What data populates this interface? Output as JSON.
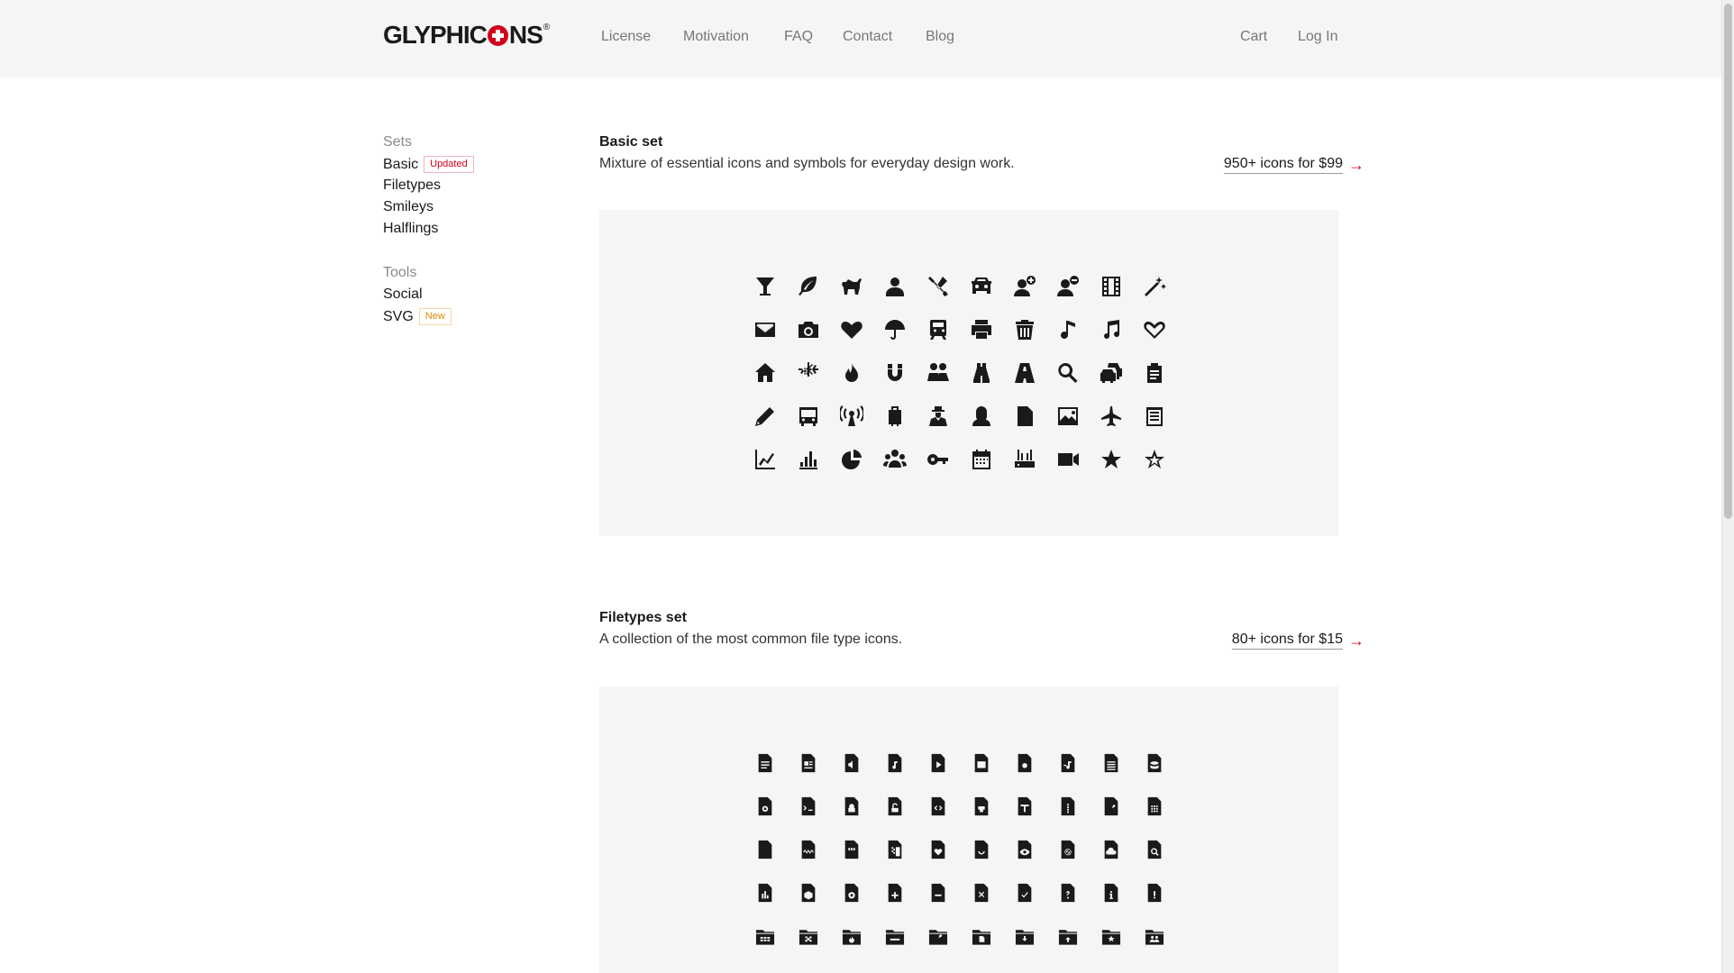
{
  "brand": {
    "logo_pre": "GLYPHIC",
    "logo_post": "NS",
    "registered": "®"
  },
  "nav": {
    "license": "License",
    "motivation": "Motivation",
    "faq": "FAQ",
    "contact": "Contact",
    "blog": "Blog",
    "cart": "Cart",
    "login": "Log In"
  },
  "sidebar": {
    "sets_heading": "Sets",
    "sets": [
      {
        "label": "Basic",
        "badge": "Updated"
      },
      {
        "label": "Filetypes"
      },
      {
        "label": "Smileys"
      },
      {
        "label": "Halflings"
      }
    ],
    "tools_heading": "Tools",
    "tools": [
      {
        "label": "Social"
      },
      {
        "label": "SVG",
        "badge": "New"
      }
    ]
  },
  "sections": {
    "basic": {
      "title": "Basic set",
      "description": "Mixture of essential icons and symbols for everyday design work.",
      "cta": "950+ icons for $99",
      "icons": [
        "glass-icon",
        "leaf-icon",
        "dog-icon",
        "user-icon",
        "tools-icon",
        "car-icon",
        "user-add-icon",
        "user-remove-icon",
        "film-icon",
        "magic-wand-icon",
        "envelope-icon",
        "camera-icon",
        "heart-icon",
        "umbrella-icon",
        "train-icon",
        "print-icon",
        "trash-icon",
        "music-note-icon",
        "music-notes-icon",
        "heart-outline-icon",
        "home-icon",
        "snowflake-icon",
        "fire-icon",
        "magnet-icon",
        "parents-icon",
        "binoculars-icon",
        "road-icon",
        "search-icon",
        "cars-icon",
        "clipboard-icon",
        "pencil-icon",
        "bus-icon",
        "antenna-icon",
        "luggage-icon",
        "woman-icon",
        "user-silhouette-icon",
        "file-icon",
        "picture-icon",
        "airplane-icon",
        "notepad-icon",
        "line-chart-icon",
        "bar-chart-icon",
        "pie-chart-icon",
        "group-icon",
        "key-icon",
        "calendar-icon",
        "router-icon",
        "video-camera-icon",
        "star-icon",
        "star-outline-icon"
      ]
    },
    "filetypes": {
      "title": "Filetypes set",
      "description": "A collection of the most common file type icons.",
      "cta": "80+ icons for $15",
      "icons": [
        "file-text-icon",
        "file-card-icon",
        "file-audio-icon",
        "file-music-icon",
        "file-video-icon",
        "file-image-icon",
        "file-camera-icon",
        "file-playlist-icon",
        "file-list-icon",
        "file-database-icon",
        "file-settings-icon",
        "file-terminal-icon",
        "file-lock-icon",
        "file-unlock-icon",
        "file-code-icon",
        "file-print-icon",
        "file-type-icon",
        "file-zip-icon",
        "file-tool-icon",
        "file-grid-icon",
        "file-blank-icon",
        "file-wave-icon",
        "file-sd-icon",
        "file-archive-icon",
        "file-heart-icon",
        "file-smile-icon",
        "file-eye-icon",
        "file-blocked-icon",
        "file-cloud-icon",
        "file-search-icon",
        "file-chart-icon",
        "file-box-icon",
        "file-target-icon",
        "file-plus-icon",
        "file-minus-icon",
        "file-remove-icon",
        "file-check-icon",
        "file-question-icon",
        "file-info-icon",
        "file-alert-icon",
        "folder-grid-icon",
        "folder-flower-icon",
        "folder-fire-icon",
        "folder-minus-icon",
        "folder-tool-icon",
        "folder-file-icon",
        "folder-download-icon",
        "folder-upload-icon",
        "folder-star-icon",
        "folder-users-icon"
      ]
    }
  }
}
